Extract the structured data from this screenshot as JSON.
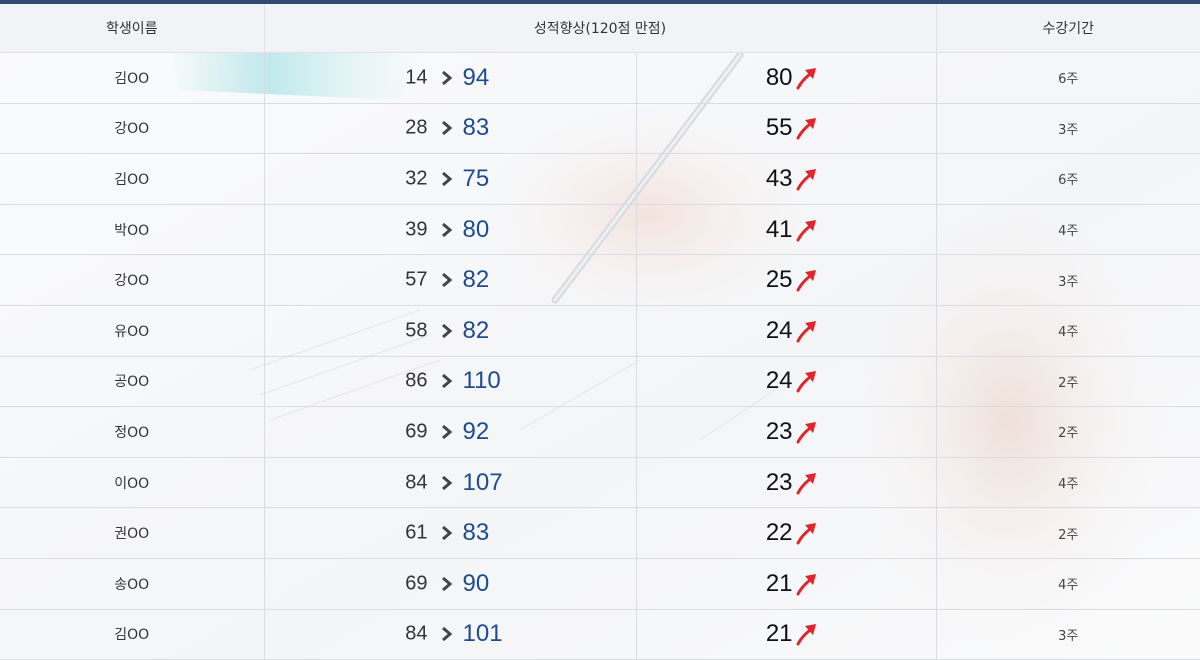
{
  "header": {
    "name": "학생이름",
    "improvement": "성적향상(120점 만점)",
    "period": "수강기간"
  },
  "colors": {
    "accent_bar": "#2f4a72",
    "after_score": "#1f4b8e",
    "arrow": "#e0262b"
  },
  "rows": [
    {
      "name": "김OO",
      "before": "14",
      "after": "94",
      "gain": "80",
      "period": "6주"
    },
    {
      "name": "강OO",
      "before": "28",
      "after": "83",
      "gain": "55",
      "period": "3주"
    },
    {
      "name": "김OO",
      "before": "32",
      "after": "75",
      "gain": "43",
      "period": "6주"
    },
    {
      "name": "박OO",
      "before": "39",
      "after": "80",
      "gain": "41",
      "period": "4주"
    },
    {
      "name": "강OO",
      "before": "57",
      "after": "82",
      "gain": "25",
      "period": "3주"
    },
    {
      "name": "유OO",
      "before": "58",
      "after": "82",
      "gain": "24",
      "period": "4주"
    },
    {
      "name": "공OO",
      "before": "86",
      "after": "110",
      "gain": "24",
      "period": "2주"
    },
    {
      "name": "정OO",
      "before": "69",
      "after": "92",
      "gain": "23",
      "period": "2주"
    },
    {
      "name": "이OO",
      "before": "84",
      "after": "107",
      "gain": "23",
      "period": "4주"
    },
    {
      "name": "권OO",
      "before": "61",
      "after": "83",
      "gain": "22",
      "period": "2주"
    },
    {
      "name": "송OO",
      "before": "69",
      "after": "90",
      "gain": "21",
      "period": "4주"
    },
    {
      "name": "김OO",
      "before": "84",
      "after": "101",
      "gain": "21",
      "period": "3주"
    }
  ]
}
